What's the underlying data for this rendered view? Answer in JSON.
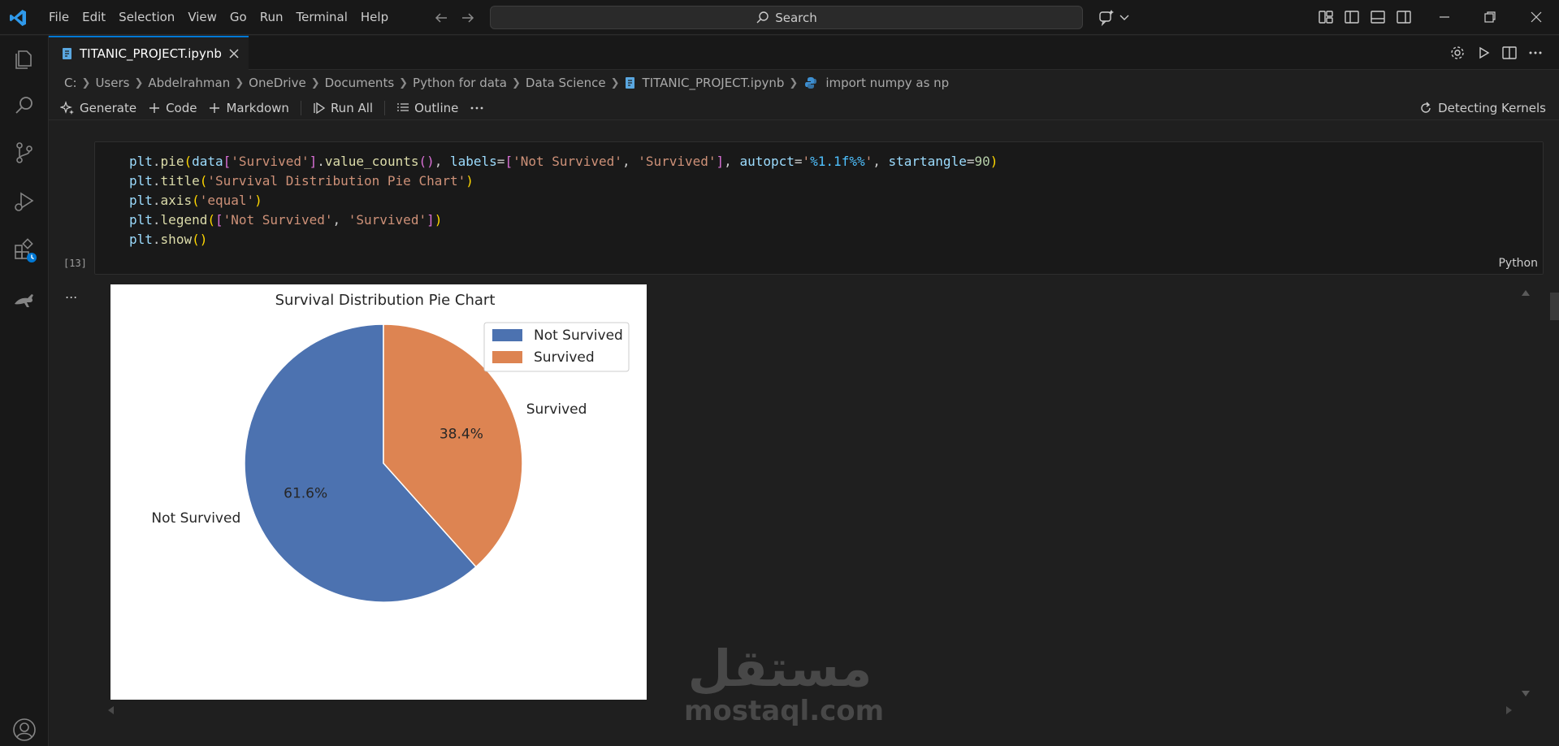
{
  "menubar": {
    "items": [
      "File",
      "Edit",
      "Selection",
      "View",
      "Go",
      "Run",
      "Terminal",
      "Help"
    ]
  },
  "search": {
    "label": "Search"
  },
  "tabs": {
    "active": {
      "label": "TITANIC_PROJECT.ipynb"
    }
  },
  "breadcrumb": {
    "items": [
      "C:",
      "Users",
      "Abdelrahman",
      "OneDrive",
      "Documents",
      "Python for data",
      "Data Science",
      "TITANIC_PROJECT.ipynb",
      "import numpy as np"
    ]
  },
  "notebook_toolbar": {
    "generate": "Generate",
    "code": "Code",
    "markdown": "Markdown",
    "run_all": "Run All",
    "outline": "Outline",
    "kernel_status": "Detecting Kernels"
  },
  "cell": {
    "execution_count": "[13]",
    "language": "Python",
    "output_more": "..."
  },
  "colors": {
    "accent": "#0078d4",
    "series_not_survived": "#4c72b0",
    "series_survived": "#dd8452"
  },
  "chart_data": {
    "type": "pie",
    "title": "Survival Distribution Pie Chart",
    "categories": [
      "Not Survived",
      "Survived"
    ],
    "values": [
      61.6,
      38.4
    ],
    "data_labels": [
      "61.6%",
      "38.4%"
    ],
    "startangle": 90,
    "legend": {
      "entries": [
        "Not Survived",
        "Survived"
      ],
      "placement": "upper-right"
    },
    "colors": [
      "#4c72b0",
      "#dd8452"
    ]
  },
  "watermark": {
    "arabic": "مستقل",
    "latin": "mostaql.com"
  }
}
